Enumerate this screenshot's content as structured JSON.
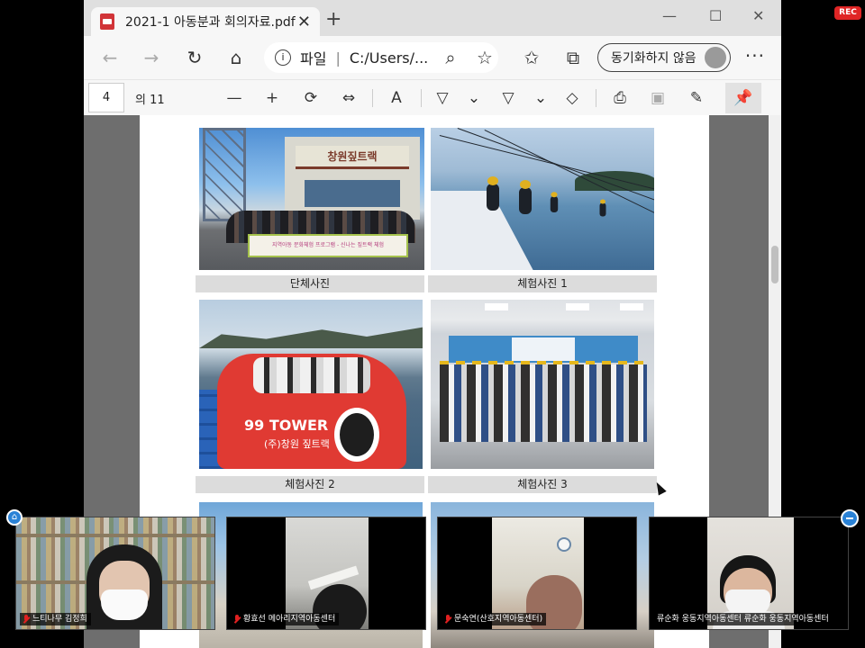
{
  "browser": {
    "tab_title": "2021-1 아동분과 회의자료.pdf",
    "tab_close": "✕",
    "new_tab": "+",
    "url_label": "파일",
    "url_path": "C:/Users/...",
    "sync_label": "동기화하지 않음",
    "more": "···"
  },
  "pdf_toolbar": {
    "page_value": "4",
    "page_total": "의 11"
  },
  "document": {
    "captions": [
      "단체사진",
      "체험사진 1",
      "체험사진 2",
      "체험사진 3"
    ],
    "photo1_sign": "창원짚트랙",
    "photo1_banner": "지역아동 문화체험 프로그램 - 신나는 짚트랙 체험",
    "photo3_brand": "99 TOWER",
    "photo3_sub": "(주)창원 짚트랙"
  },
  "participants": [
    {
      "name": "느티나무 김정희"
    },
    {
      "name": "황효선 메아리지역아동센터"
    },
    {
      "name": "문숙연(산호지역아동센터)"
    },
    {
      "name": "류순화 웅동지역아동센터 류순화 웅동지역아동센터"
    }
  ],
  "recording_badge": "REC",
  "colors": {
    "accent": "#2a82d6",
    "record": "#e02525",
    "pdf_icon": "#d13438"
  }
}
